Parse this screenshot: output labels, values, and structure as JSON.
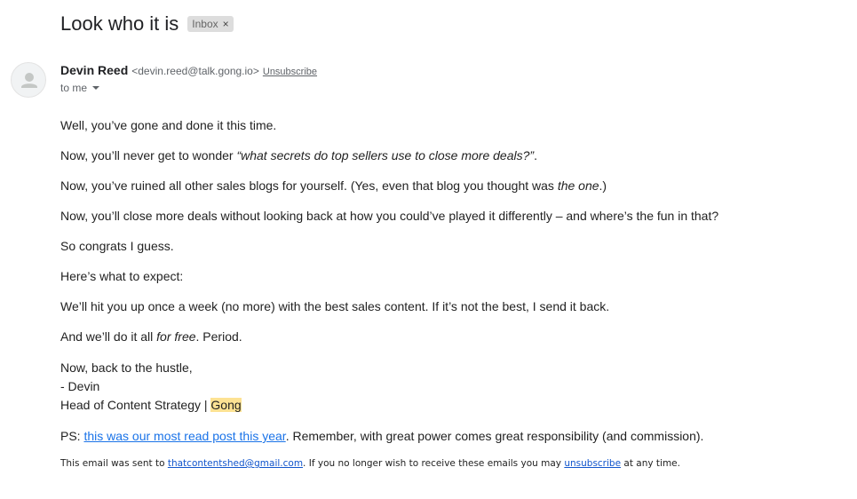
{
  "email": {
    "subject": "Look who it is",
    "label": "Inbox",
    "label_remove": "×",
    "sender": {
      "name": "Devin Reed",
      "email": "<devin.reed@talk.gong.io>",
      "unsubscribe": "Unsubscribe"
    },
    "recipient": "to me",
    "avatar_icon": "person-icon"
  },
  "body": {
    "p1": "Well, you’ve gone and done it this time.",
    "p2_prefix": "Now, you’ll never get to wonder ",
    "p2_italic": "“what secrets do top sellers use to close more deals?”",
    "p2_suffix": ".",
    "p3_prefix": "Now, you’ve ruined all other sales blogs for yourself. (Yes, even that blog you thought was ",
    "p3_italic": "the one",
    "p3_suffix": ".)",
    "p4": "Now, you’ll close more deals without looking back at how you could’ve played it differently – and where’s the fun in that?",
    "p5": "So congrats I guess.",
    "p6": "Here’s what to expect:",
    "p7": "We’ll hit you up once a week (no more) with the best sales content. If it’s not the best, I send it back.",
    "p8_prefix": "And we’ll do it all ",
    "p8_italic": "for free",
    "p8_suffix": ". Period.",
    "sig_line1": "Now, back to the hustle,",
    "sig_line2": "- Devin",
    "sig_line3_prefix": "Head of Content Strategy | ",
    "sig_line3_highlight": "Gong",
    "ps_prefix": "PS: ",
    "ps_link": "this was our most read post this year",
    "ps_suffix": ". Remember, with great power comes great responsibility (and commission)."
  },
  "footer": {
    "prefix": "This email was sent to ",
    "email_link": "thatcontentshed@gmail.com",
    "middle": ". If you no longer wish to receive these emails you may ",
    "unsubscribe_link": "unsubscribe",
    "suffix": " at any time."
  },
  "colors": {
    "link": "#1a73e8",
    "highlight": "#fde293",
    "label_chip": "#dddddd"
  }
}
